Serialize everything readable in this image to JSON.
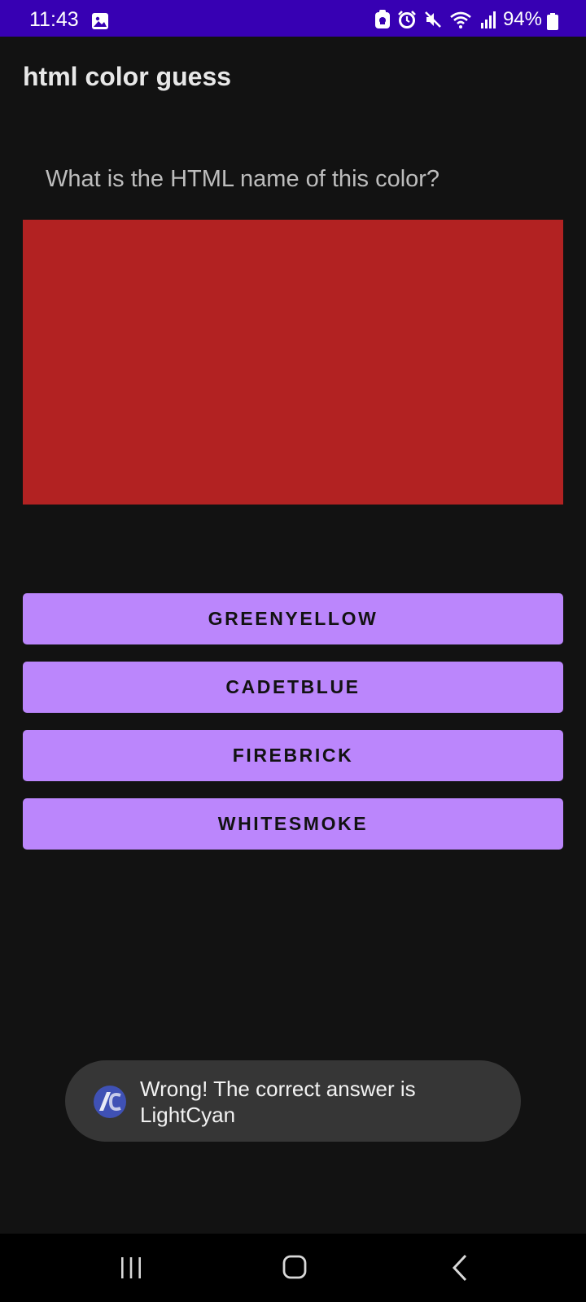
{
  "status_bar": {
    "time": "11:43",
    "battery": "94%",
    "color": "#3700b3",
    "icons": [
      "gallery-icon",
      "cloud-lock-icon",
      "alarm-icon",
      "mute-icon",
      "wifi-icon",
      "signal-icon",
      "battery-icon"
    ]
  },
  "app": {
    "title": "html color guess"
  },
  "quiz": {
    "question": "What is the HTML name of this color?",
    "swatch_color": "#b22222",
    "options": [
      "GREENYELLOW",
      "CADETBLUE",
      "FIREBRICK",
      "WHITESMOKE"
    ],
    "button_color": "#bb86fc"
  },
  "toast": {
    "message": "Wrong! The correct answer is LightCyan",
    "icon": "app-icon"
  },
  "nav_bar": {
    "icons": [
      "recents-icon",
      "home-icon",
      "back-icon"
    ]
  }
}
